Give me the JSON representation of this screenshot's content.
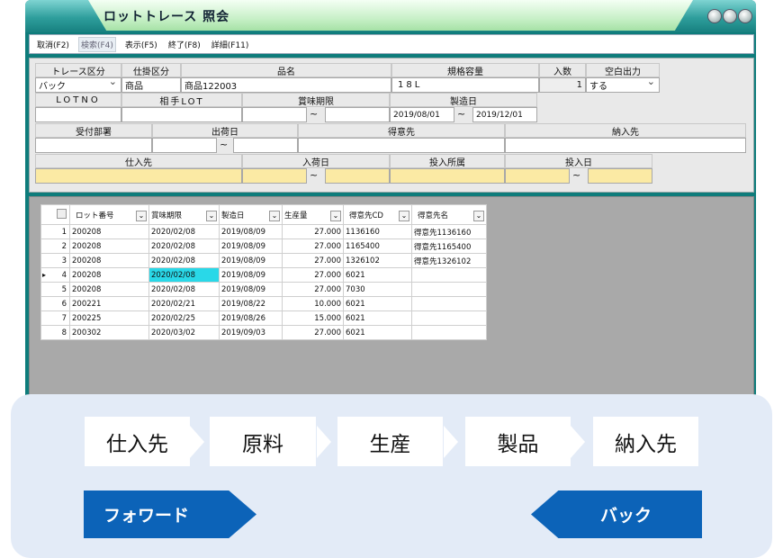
{
  "window": {
    "title": "ロットトレース 照会"
  },
  "menu": [
    "取消(F2)",
    "検索(F4)",
    "表示(F5)",
    "終了(F8)",
    "詳細(F11)"
  ],
  "form": {
    "labels": {
      "trace_kubun": "トレース区分",
      "shikake_kubun": "仕掛区分",
      "hinmei": "品名",
      "kikaku": "規格容量",
      "irisu": "入数",
      "kuuhaku": "空白出力",
      "lotno": "LOTNO",
      "aite_lot": "相手LOT",
      "shoumi": "賞味期限",
      "seizoubi": "製造日",
      "uketsuke": "受付部署",
      "shukkabi": "出荷日",
      "tokuisaki": "得意先",
      "nounyuusaki": "納入先",
      "shiiresaki": "仕入先",
      "nyuukabi": "入荷日",
      "tounyuu_busho": "投入所属",
      "tounyuubi": "投入日"
    },
    "values": {
      "trace_kubun": "バック",
      "shikake_kubun": "商品",
      "hinmei": "商品122003",
      "kikaku": "18L",
      "irisu": "1",
      "kuuhaku": "する",
      "seizou_from": "2019/08/01",
      "seizou_to": "2019/12/01"
    },
    "tilde": "~"
  },
  "grid": {
    "headers": [
      "ロット番号",
      "賞味期限",
      "製造日",
      "生産量",
      "得意先CD",
      "得意先名"
    ],
    "rows": [
      [
        "1",
        "200208",
        "2020/02/08",
        "2019/08/09",
        "27.000",
        "1136160",
        "得意先1136160"
      ],
      [
        "2",
        "200208",
        "2020/02/08",
        "2019/08/09",
        "27.000",
        "1165400",
        "得意先1165400"
      ],
      [
        "3",
        "200208",
        "2020/02/08",
        "2019/08/09",
        "27.000",
        "1326102",
        "得意先1326102"
      ],
      [
        "4",
        "200208",
        "2020/02/08",
        "2019/08/09",
        "27.000",
        "6021",
        ""
      ],
      [
        "5",
        "200208",
        "2020/02/08",
        "2019/08/09",
        "27.000",
        "7030",
        ""
      ],
      [
        "6",
        "200221",
        "2020/02/21",
        "2019/08/22",
        "10.000",
        "6021",
        ""
      ],
      [
        "7",
        "200225",
        "2020/02/25",
        "2019/08/26",
        "15.000",
        "6021",
        ""
      ],
      [
        "8",
        "200302",
        "2020/03/02",
        "2019/09/03",
        "27.000",
        "6021",
        ""
      ]
    ],
    "selected_row": 4
  },
  "flow": {
    "steps": [
      "仕入先",
      "原料",
      "生産",
      "製品",
      "納入先"
    ],
    "forward": "フォワード",
    "back": "バック"
  },
  "colors": {
    "window": "#0e7c7b",
    "highlight": "#29d8e8",
    "yellow_field": "#fbeaa4",
    "arrow_blue": "#0c63b8"
  }
}
